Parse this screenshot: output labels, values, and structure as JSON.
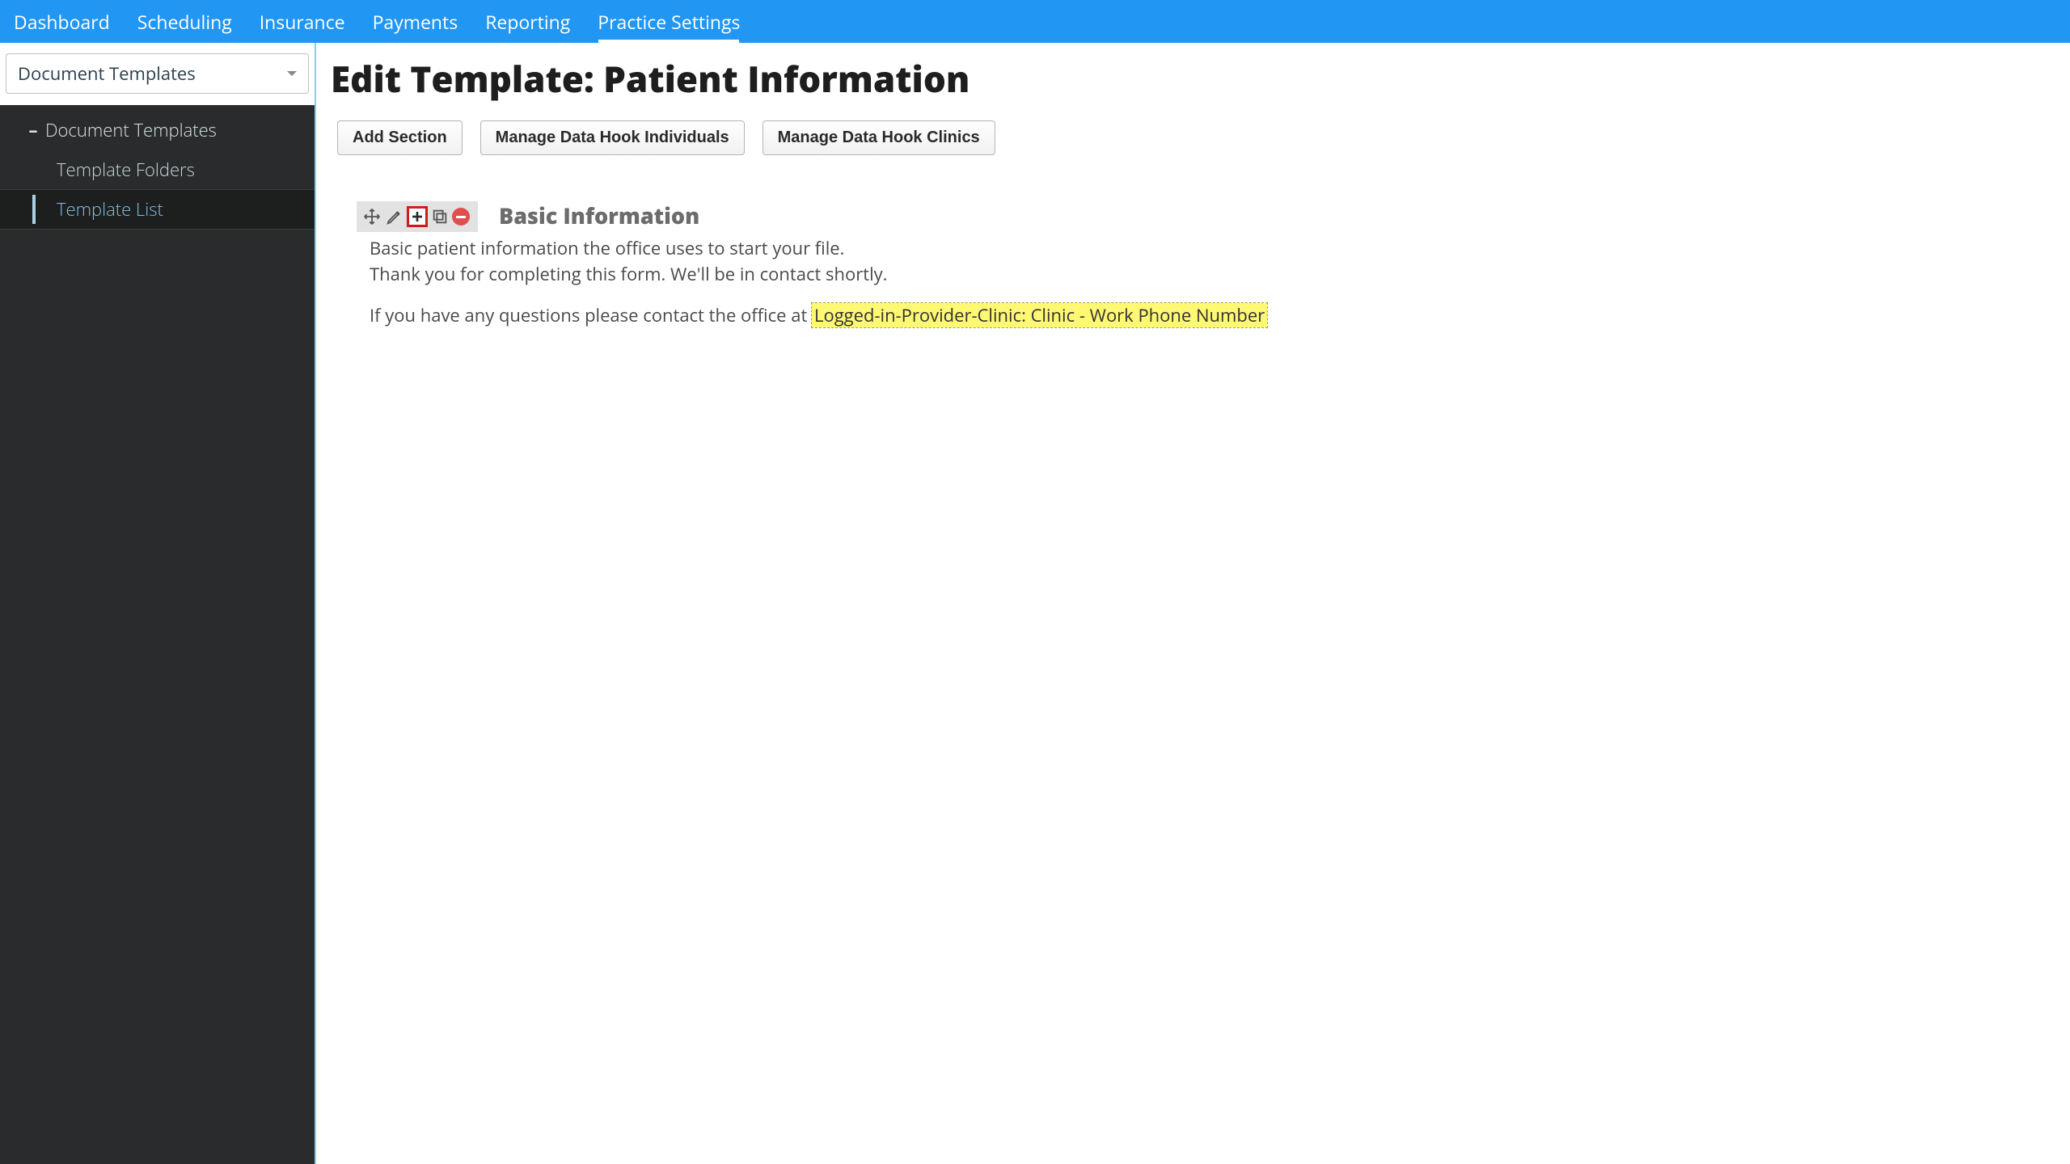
{
  "topnav": {
    "tabs": [
      {
        "label": "Dashboard"
      },
      {
        "label": "Scheduling"
      },
      {
        "label": "Insurance"
      },
      {
        "label": "Payments"
      },
      {
        "label": "Reporting"
      },
      {
        "label": "Practice Settings",
        "active": true
      }
    ]
  },
  "sidebar": {
    "selector_label": "Document Templates",
    "tree": {
      "root_label": "Document Templates",
      "children": [
        {
          "label": "Template Folders"
        },
        {
          "label": "Template List",
          "active": true
        }
      ]
    }
  },
  "main": {
    "title": "Edit Template: Patient Information",
    "toolbar": {
      "add_section": "Add Section",
      "manage_individuals": "Manage Data Hook Individuals",
      "manage_clinics": "Manage Data Hook Clinics"
    },
    "section": {
      "title": "Basic Information",
      "line1": "Basic patient information the office uses to start your file.",
      "line2": "Thank you for completing this form. We'll be in contact shortly.",
      "line3_prefix": "If you have any questions please contact the office at ",
      "datahook_label": "Logged-in-Provider-Clinic: Clinic - Work Phone Number"
    },
    "section_tools": {
      "move": "move-icon",
      "edit": "edit-icon",
      "add": "plus-icon",
      "copy": "copy-icon",
      "remove": "minus-icon"
    }
  }
}
